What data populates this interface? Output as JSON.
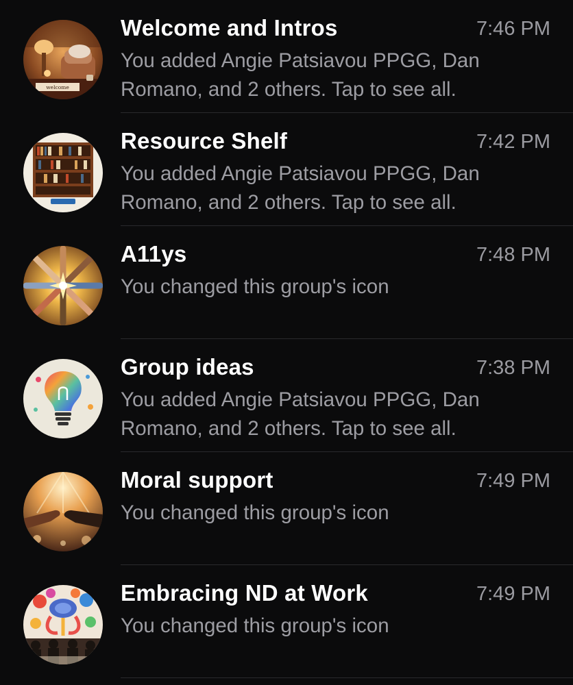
{
  "chats": [
    {
      "title": "Welcome and Intros",
      "time": "7:46 PM",
      "preview": "You added Angie Patsiavou PPGG, Dan Romano, and 2 others. Tap to see all.",
      "avatar_icon": "cozy-room-welcome-icon",
      "avatar_text": "welcome"
    },
    {
      "title": "Resource Shelf",
      "time": "7:42 PM",
      "preview": "You added Angie Patsiavou PPGG, Dan Romano, and 2 others. Tap to see all.",
      "avatar_icon": "bookshelf-icon"
    },
    {
      "title": "A11ys",
      "time": "7:48 PM",
      "preview": "You changed this group's icon",
      "avatar_icon": "joined-hands-star-icon"
    },
    {
      "title": "Group ideas",
      "time": "7:38 PM",
      "preview": "You added Angie Patsiavou PPGG, Dan Romano, and 2 others. Tap to see all.",
      "avatar_icon": "lightbulb-icon"
    },
    {
      "title": "Moral support",
      "time": "7:49 PM",
      "preview": "You changed this group's icon",
      "avatar_icon": "helping-hands-icon"
    },
    {
      "title": "Embracing ND at Work",
      "time": "7:49 PM",
      "preview": "You changed this group's icon",
      "avatar_icon": "colorful-brain-meeting-icon"
    }
  ],
  "colors": {
    "background": "#0b0b0c",
    "title": "#ffffff",
    "secondary_text": "#9d9da3",
    "divider": "#2a2a2d"
  }
}
